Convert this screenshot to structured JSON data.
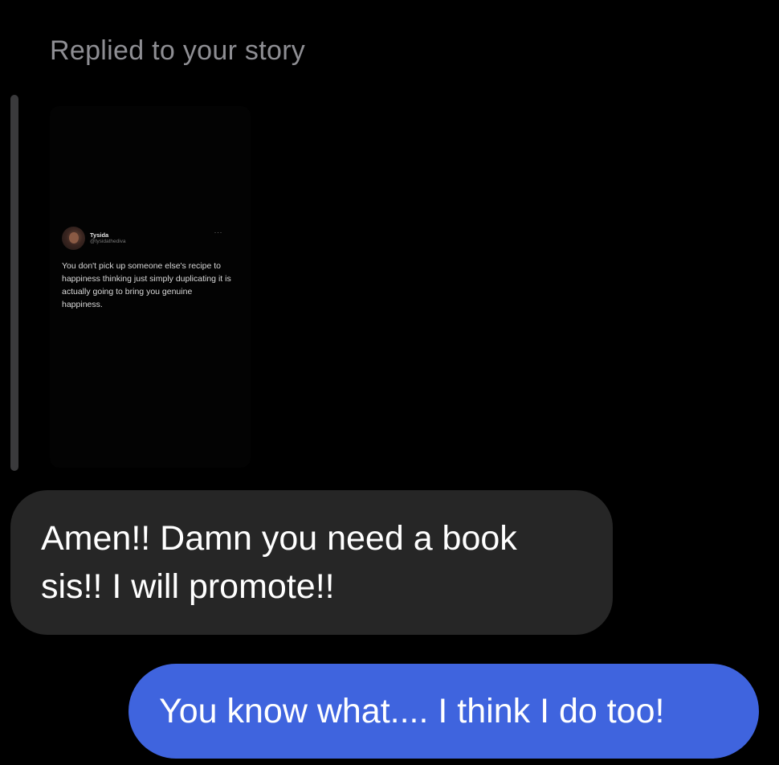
{
  "conversation": {
    "reply_label": "Replied to your story",
    "story": {
      "tweet": {
        "name": "Tysida",
        "handle": "@tysidathediva",
        "more": "···",
        "text": "You don't pick up someone else's recipe to happiness thinking just simply duplicating it is actually going to bring you genuine happiness."
      }
    },
    "messages": [
      {
        "direction": "incoming",
        "text": "Amen!! Damn you need a book sis!! I will promote!!"
      },
      {
        "direction": "outgoing",
        "text": "You know what.... I think I do too!"
      }
    ]
  },
  "colors": {
    "background": "#000000",
    "incoming_bubble": "#262626",
    "outgoing_bubble": "#3f64de",
    "secondary_text": "#8e8e93"
  }
}
